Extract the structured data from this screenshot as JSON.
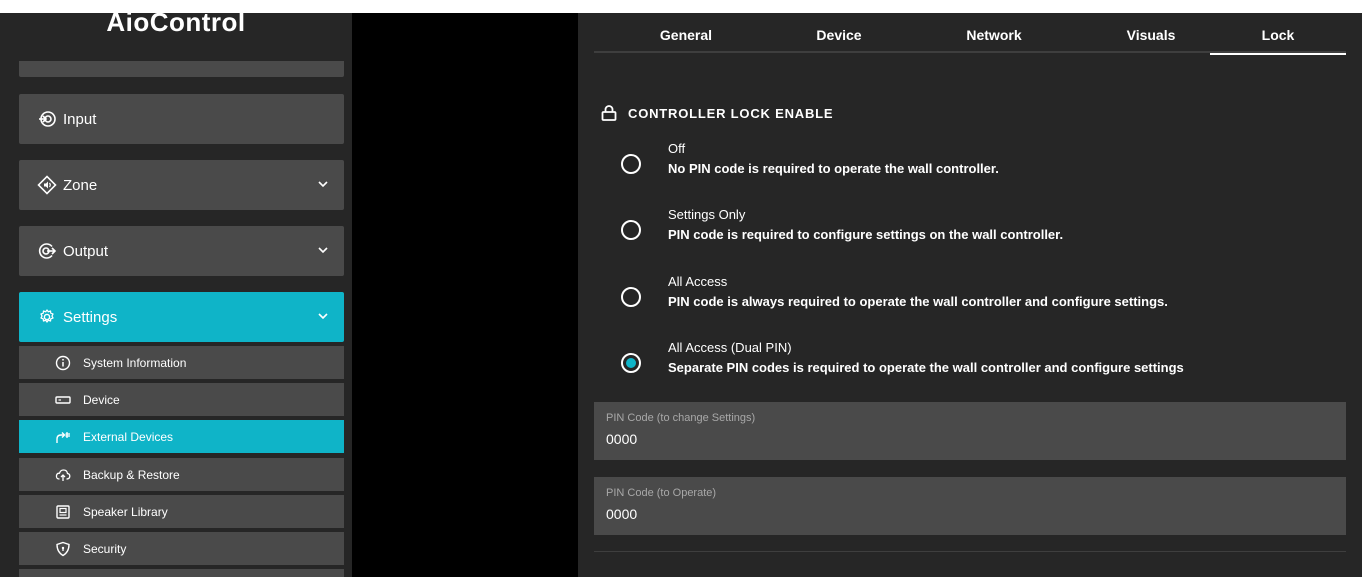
{
  "app": {
    "title": "AioControl"
  },
  "sidebar": {
    "items": [
      {
        "label": "Input",
        "icon": "input-icon",
        "expandable": false
      },
      {
        "label": "Zone",
        "icon": "zone-icon",
        "expandable": true
      },
      {
        "label": "Output",
        "icon": "output-icon",
        "expandable": true
      },
      {
        "label": "Settings",
        "icon": "gear-icon",
        "expandable": true,
        "active": true
      }
    ],
    "subitems": [
      {
        "label": "System Information",
        "icon": "info-icon"
      },
      {
        "label": "Device",
        "icon": "device-icon"
      },
      {
        "label": "External Devices",
        "icon": "external-devices-icon",
        "active": true
      },
      {
        "label": "Backup & Restore",
        "icon": "cloud-upload-icon"
      },
      {
        "label": "Speaker Library",
        "icon": "speaker-library-icon"
      },
      {
        "label": "Security",
        "icon": "shield-icon"
      }
    ]
  },
  "tabs": [
    {
      "label": "General"
    },
    {
      "label": "Device"
    },
    {
      "label": "Network"
    },
    {
      "label": "Visuals"
    },
    {
      "label": "Lock",
      "active": true
    }
  ],
  "lock": {
    "section_title": "CONTROLLER LOCK ENABLE",
    "options": [
      {
        "title": "Off",
        "description": "No PIN code is required to operate the wall controller.",
        "selected": false
      },
      {
        "title": "Settings Only",
        "description": "PIN code is required to configure settings on the wall controller.",
        "selected": false
      },
      {
        "title": "All Access",
        "description": "PIN code is always required to operate the wall controller and configure settings.",
        "selected": false
      },
      {
        "title": "All Access (Dual PIN)",
        "description": "Separate PIN codes is required to operate the wall controller and configure settings",
        "selected": true
      }
    ],
    "fields": [
      {
        "label": "PIN Code (to change Settings)",
        "value": "0000"
      },
      {
        "label": "PIN Code (to Operate)",
        "value": "0000"
      }
    ]
  },
  "colors": {
    "accent": "#0fb4c8",
    "panel": "#262626",
    "item": "#4a4a4a"
  }
}
